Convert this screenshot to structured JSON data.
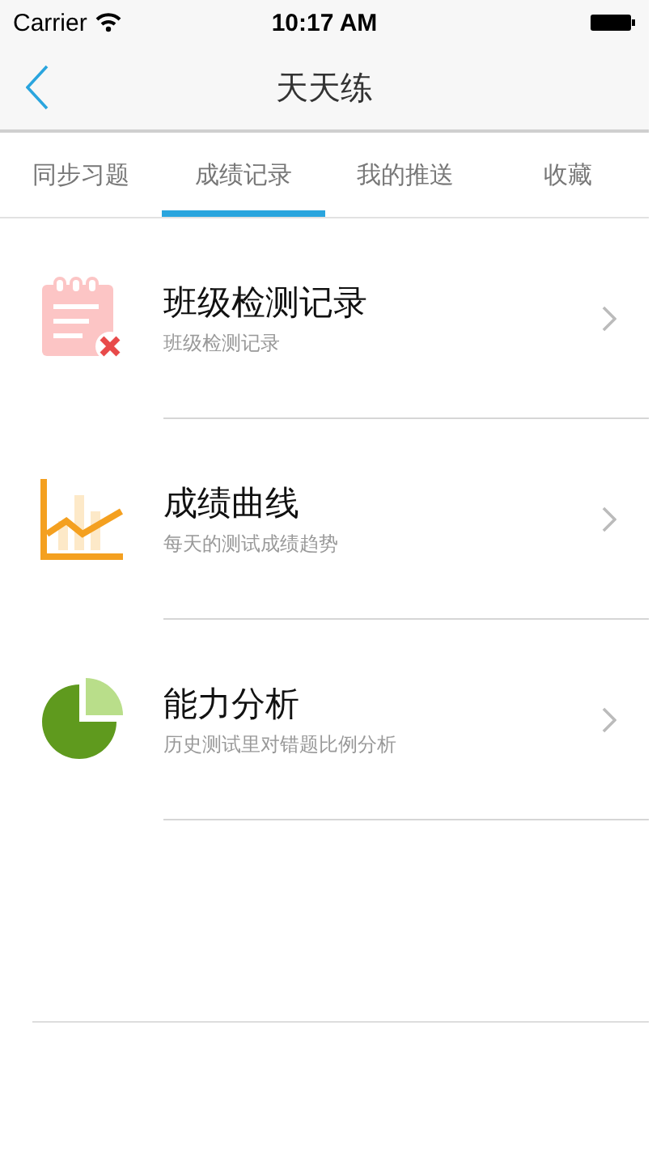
{
  "status_bar": {
    "carrier": "Carrier",
    "time": "10:17 AM"
  },
  "nav": {
    "title": "天天练"
  },
  "tabs": [
    {
      "label": "同步习题",
      "selected": false
    },
    {
      "label": "成绩记录",
      "selected": true
    },
    {
      "label": "我的推送",
      "selected": false
    },
    {
      "label": "收藏",
      "selected": false
    }
  ],
  "items": [
    {
      "kind": "record",
      "title": "班级检测记录",
      "subtitle": "班级检测记录"
    },
    {
      "kind": "chart",
      "title": "成绩曲线",
      "subtitle": "每天的测试成绩趋势"
    },
    {
      "kind": "pie",
      "title": "能力分析",
      "subtitle": "历史测试里对错题比例分析"
    }
  ]
}
